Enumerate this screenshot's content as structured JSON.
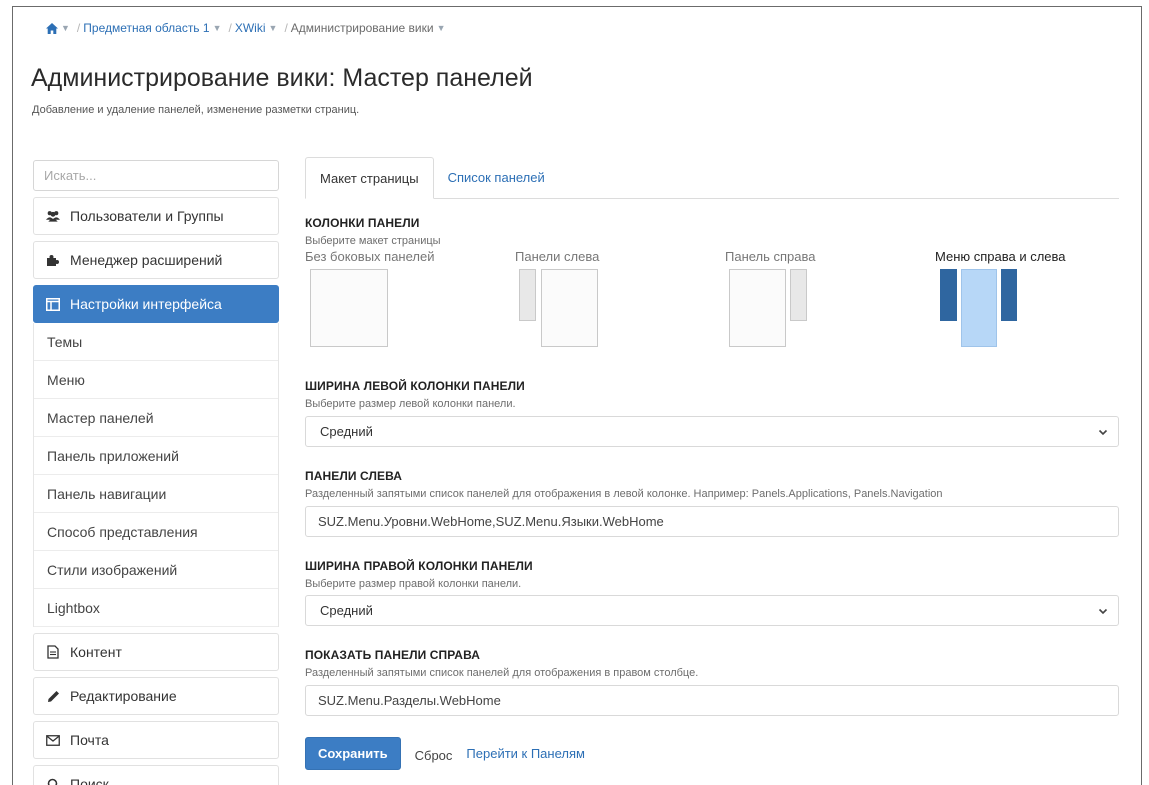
{
  "breadcrumb": {
    "items": [
      {
        "label": "Предметная область 1",
        "caret": "▼"
      },
      {
        "label": "XWiki",
        "caret": "▼"
      },
      {
        "label": "Администрирование вики",
        "caret": "▼"
      }
    ],
    "separator": "/"
  },
  "page": {
    "title": "Администрирование вики: Мастер панелей",
    "subtitle": "Добавление и удаление панелей, изменение разметки страниц."
  },
  "sidebar": {
    "search_placeholder": "Искать...",
    "categories_top": [
      {
        "label": "Пользователи и Группы",
        "icon": "users-icon"
      },
      {
        "label": "Менеджер расширений",
        "icon": "puzzle-icon"
      },
      {
        "label": "Настройки интерфейса",
        "icon": "layout-icon",
        "active": true
      }
    ],
    "sub_items": [
      "Темы",
      "Меню",
      "Мастер панелей",
      "Панель приложений",
      "Панель навигации",
      "Способ представления",
      "Стили изображений",
      "Lightbox"
    ],
    "categories_bottom": [
      {
        "label": "Контент",
        "icon": "document-icon"
      },
      {
        "label": "Редактирование",
        "icon": "pencil-icon"
      },
      {
        "label": "Почта",
        "icon": "envelope-icon"
      },
      {
        "label": "Поиск",
        "icon": "search-icon"
      }
    ]
  },
  "tabs": [
    {
      "label": "Макет страницы",
      "active": true
    },
    {
      "label": "Список панелей",
      "active": false
    }
  ],
  "columns_section": {
    "title": "КОЛОНКИ ПАНЕЛИ",
    "hint": "Выберите макет страницы",
    "layouts": [
      {
        "label": "Без боковых панелей"
      },
      {
        "label": "Панели слева"
      },
      {
        "label": "Панель справа"
      },
      {
        "label": "Меню справа и слева",
        "selected": true
      }
    ]
  },
  "left_width": {
    "title": "ШИРИНА ЛЕВОЙ КОЛОНКИ ПАНЕЛИ",
    "hint": "Выберите размер левой колонки панели.",
    "value": "Средний"
  },
  "left_panels": {
    "title": "ПАНЕЛИ СЛЕВА",
    "hint": "Разделенный запятыми список панелей для отображения в левой колонке. Например: Panels.Applications, Panels.Navigation",
    "value": "SUZ.Menu.Уровни.WebHome,SUZ.Menu.Языки.WebHome"
  },
  "right_width": {
    "title": "ШИРИНА ПРАВОЙ КОЛОНКИ ПАНЕЛИ",
    "hint": "Выберите размер правой колонки панели.",
    "value": "Средний"
  },
  "right_panels": {
    "title": "ПОКАЗАТЬ ПАНЕЛИ СПРАВА",
    "hint": "Разделенный запятыми список панелей для отображения в правом столбце.",
    "value": "SUZ.Menu.Разделы.WebHome"
  },
  "actions": {
    "save": "Сохранить",
    "reset": "Сброс",
    "goto_panels": "Перейти к Панелям"
  },
  "colors": {
    "accent": "#3c7dc4",
    "link": "#2c6fb5",
    "layout_selected_side": "#2f66a0",
    "layout_selected_center": "#b7d7f7"
  }
}
